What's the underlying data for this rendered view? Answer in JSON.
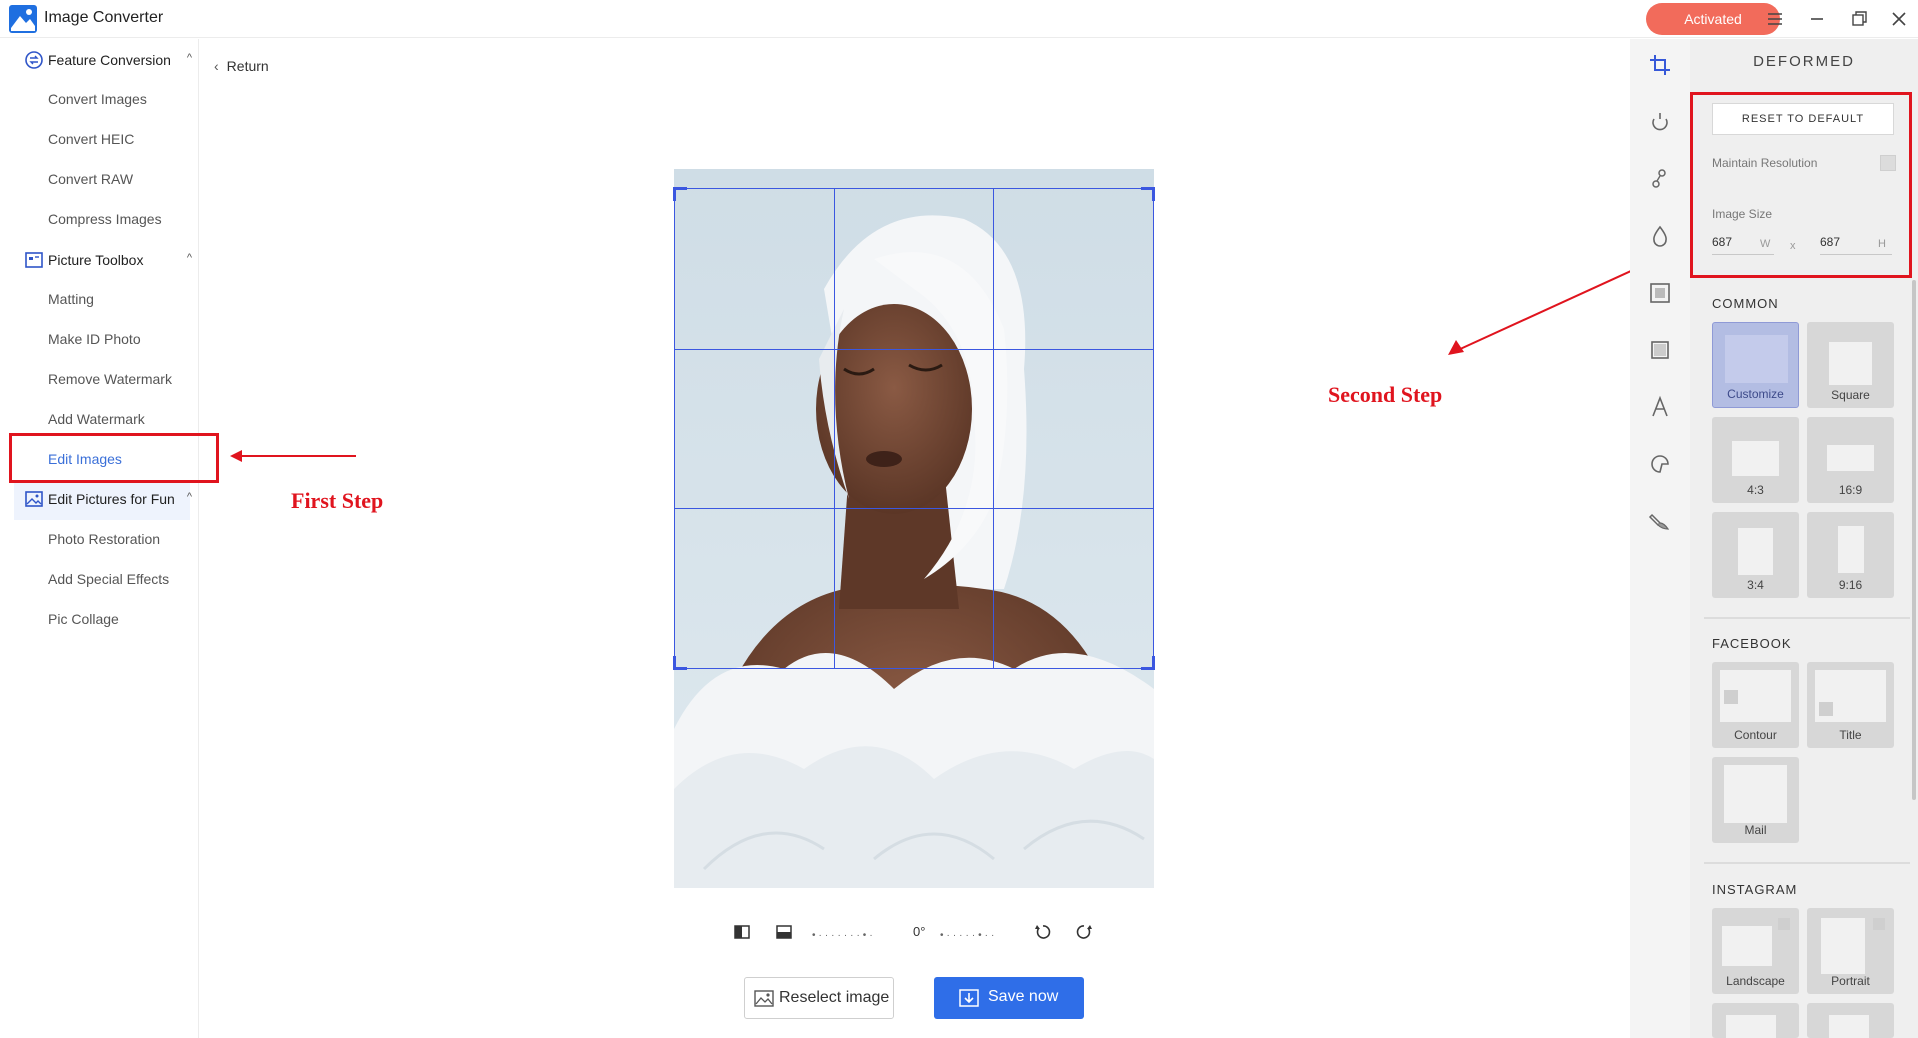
{
  "app": {
    "title": "Image Converter",
    "activated_label": "Activated"
  },
  "sidebar": {
    "groups": [
      {
        "label": "Feature Conversion",
        "items": [
          "Convert Images",
          "Convert HEIC",
          "Convert RAW",
          "Compress Images"
        ]
      },
      {
        "label": "Picture Toolbox",
        "items": [
          "Matting",
          "Make ID Photo",
          "Remove Watermark",
          "Add Watermark",
          "Edit Images"
        ]
      },
      {
        "label": "Edit Pictures for Fun",
        "items": [
          "Photo Restoration",
          "Add Special Effects",
          "Pic Collage"
        ]
      }
    ],
    "active_item": "Edit Images"
  },
  "annotations": {
    "first_step": "First Step",
    "second_step": "Second Step"
  },
  "main": {
    "return_label": "Return",
    "rotation_angle": "0°",
    "reselect_label": "Reselect image",
    "save_label": "Save now"
  },
  "panel": {
    "title": "DEFORMED",
    "reset_label": "RESET TO DEFAULT",
    "maintain_resolution_label": "Maintain Resolution",
    "image_size_label": "Image Size",
    "width_value": "687",
    "width_unit": "W",
    "height_value": "687",
    "height_unit": "H",
    "times": "x",
    "sections": {
      "common": {
        "label": "COMMON",
        "presets": [
          "Customize",
          "Square",
          "4:3",
          "16:9",
          "3:4",
          "9:16"
        ]
      },
      "facebook": {
        "label": "FACEBOOK",
        "presets": [
          "Contour",
          "Title",
          "Mail"
        ]
      },
      "instagram": {
        "label": "INSTAGRAM",
        "presets": [
          "Landscape",
          "Portrait"
        ]
      }
    }
  },
  "colors": {
    "accent": "#2f6ee8",
    "activated": "#f26b5b",
    "annotation": "#e0141e",
    "crop_grid": "#3b57e0"
  }
}
